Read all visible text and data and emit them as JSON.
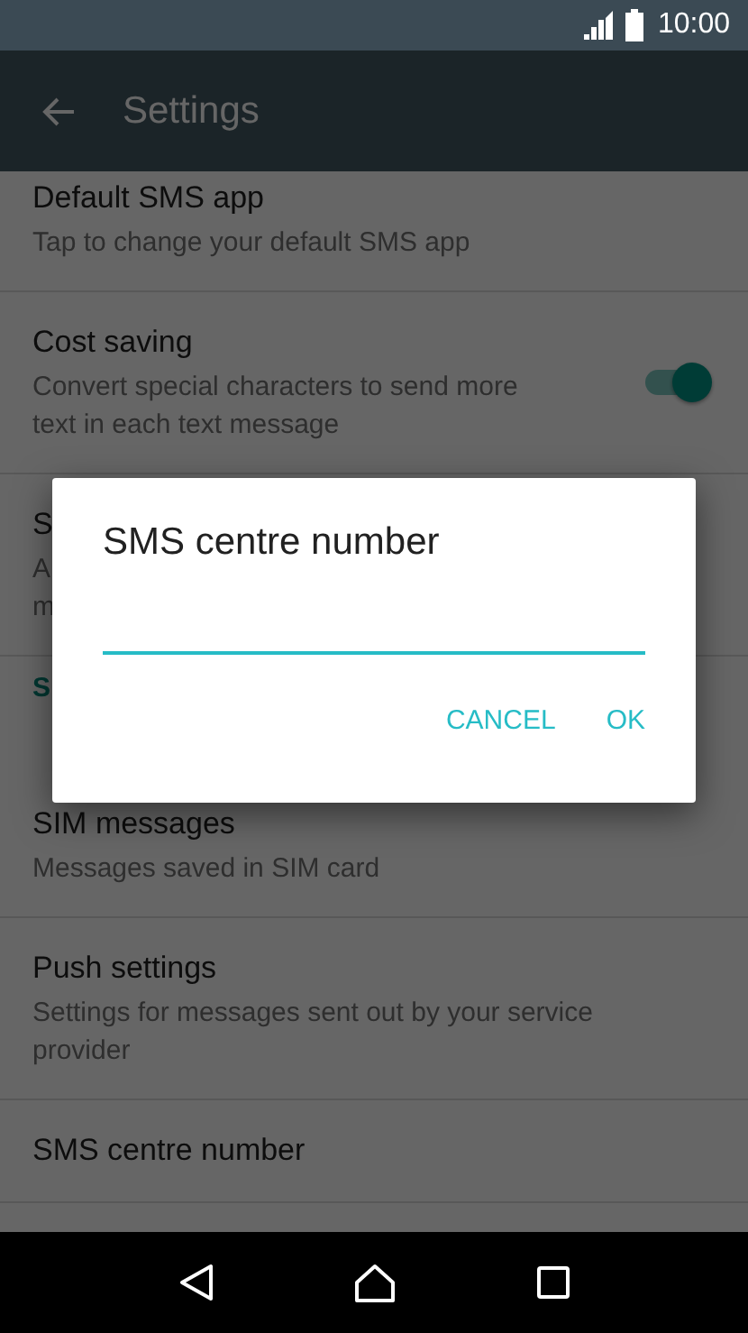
{
  "status_bar": {
    "time": "10:00"
  },
  "app_bar": {
    "title": "Settings"
  },
  "items": [
    {
      "kind": "pref",
      "title": "Default SMS app",
      "summary": "Tap to change your default SMS app"
    },
    {
      "kind": "switch",
      "title": "Cost saving",
      "summary": "Convert special characters to send more\ntext in each text message",
      "on": true
    },
    {
      "kind": "pref",
      "title": "S",
      "summary": "A\nm"
    },
    {
      "kind": "header",
      "title": "S"
    },
    {
      "kind": "pref",
      "title": "SIM messages",
      "summary": "Messages saved in SIM card"
    },
    {
      "kind": "pref",
      "title": "Push settings",
      "summary": "Settings for messages sent out by your service\nprovider"
    },
    {
      "kind": "pref",
      "title": "SMS centre number"
    }
  ],
  "dialog": {
    "title": "SMS centre number",
    "buttons": [
      "CANCEL",
      "OK"
    ]
  }
}
